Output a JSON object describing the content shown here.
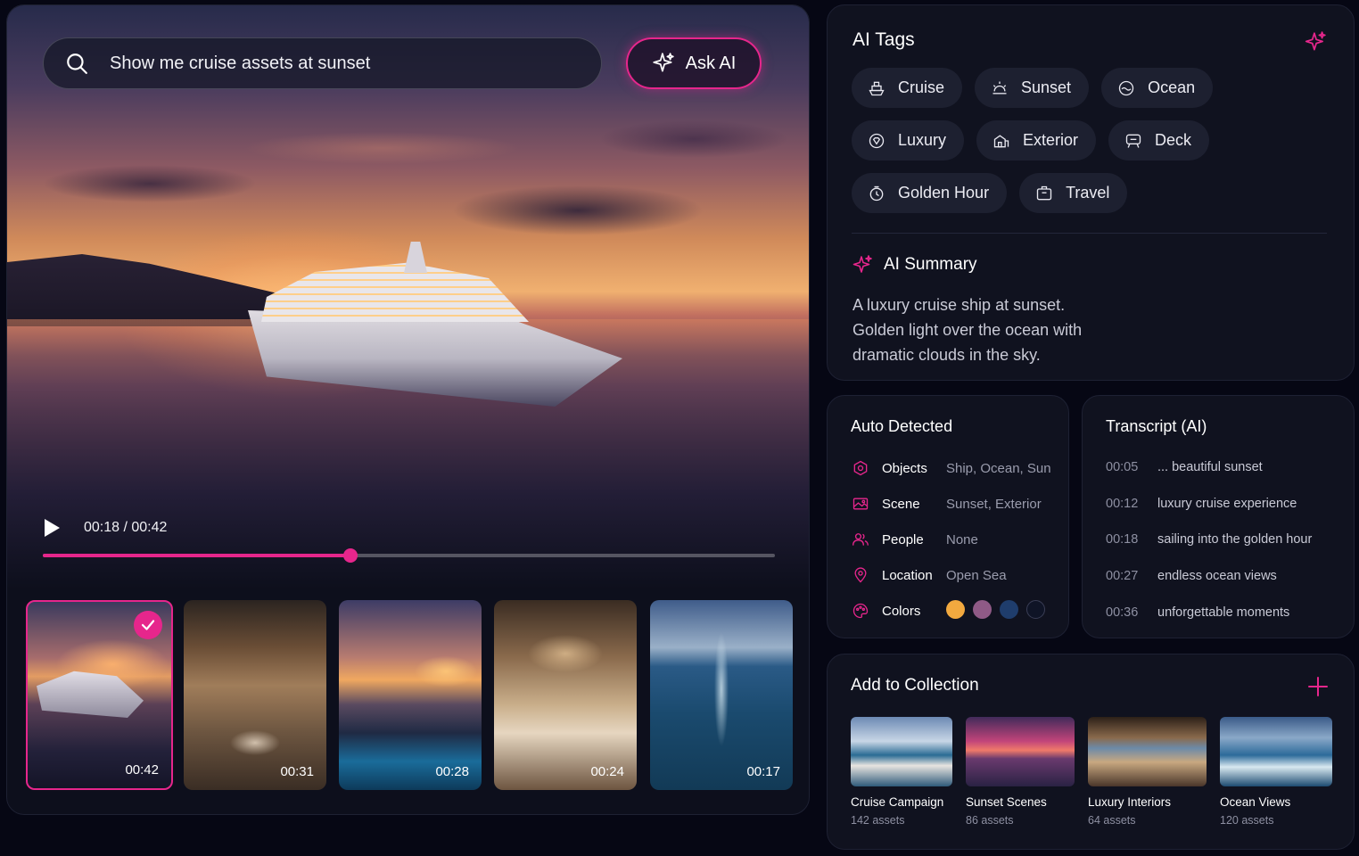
{
  "search": {
    "query": "Show me cruise assets at sunset",
    "ask_label": "Ask AI"
  },
  "player": {
    "time_text": "00:18 / 00:42",
    "progress": 0.42
  },
  "thumbnails": [
    {
      "duration": "00:42",
      "selected": true
    },
    {
      "duration": "00:31",
      "selected": false
    },
    {
      "duration": "00:28",
      "selected": false
    },
    {
      "duration": "00:24",
      "selected": false
    },
    {
      "duration": "00:17",
      "selected": false
    }
  ],
  "tags_panel": {
    "title": "AI Tags",
    "tags": [
      {
        "label": "Cruise",
        "icon": "ship-icon"
      },
      {
        "label": "Sunset",
        "icon": "sunset-icon"
      },
      {
        "label": "Ocean",
        "icon": "wave-icon"
      },
      {
        "label": "Luxury",
        "icon": "diamond-icon"
      },
      {
        "label": "Exterior",
        "icon": "building-icon"
      },
      {
        "label": "Deck",
        "icon": "deck-chair-icon"
      },
      {
        "label": "Golden Hour",
        "icon": "clock-icon"
      },
      {
        "label": "Travel",
        "icon": "luggage-icon"
      }
    ],
    "summary_title": "AI Summary",
    "summary_lines": [
      "A luxury cruise ship at sunset.",
      "Golden light over the ocean with",
      "dramatic clouds in the sky."
    ]
  },
  "auto_detected": {
    "title": "Auto Detected",
    "rows": [
      {
        "label": "Objects",
        "value": "Ship, Ocean, Sun",
        "icon": "cube-icon"
      },
      {
        "label": "Scene",
        "value": "Sunset, Exterior",
        "icon": "image-icon"
      },
      {
        "label": "People",
        "value": "None",
        "icon": "people-icon"
      },
      {
        "label": "Location",
        "value": "Open Sea",
        "icon": "location-pin-icon"
      },
      {
        "label": "Colors",
        "value": "",
        "icon": "palette-icon"
      }
    ],
    "colors": [
      "#f2a93f",
      "#8f5a86",
      "#1f3d6c",
      "#0f1426"
    ]
  },
  "transcript": {
    "title": "Transcript (AI)",
    "rows": [
      {
        "time": "00:05",
        "text": "... beautiful sunset"
      },
      {
        "time": "00:12",
        "text": "luxury cruise experience"
      },
      {
        "time": "00:18",
        "text": "sailing into the golden hour"
      },
      {
        "time": "00:27",
        "text": "endless ocean views"
      },
      {
        "time": "00:36",
        "text": "unforgettable moments"
      }
    ]
  },
  "collection": {
    "title": "Add to Collection",
    "items": [
      {
        "name": "Cruise Campaign",
        "count": "142 assets"
      },
      {
        "name": "Sunset Scenes",
        "count": "86 assets"
      },
      {
        "name": "Luxury Interiors",
        "count": "64 assets"
      },
      {
        "name": "Ocean Views",
        "count": "120 assets"
      }
    ]
  },
  "colors": {
    "accent": "#e6268c",
    "panel": "#10121f",
    "background": "#060714"
  }
}
